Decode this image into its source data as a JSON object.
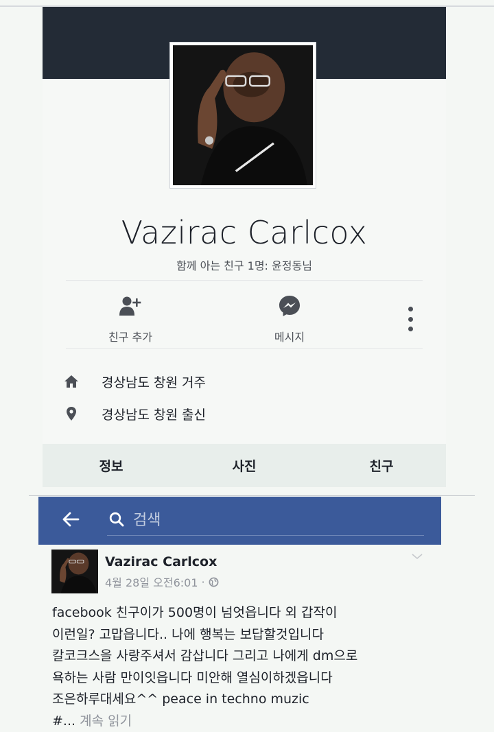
{
  "profile": {
    "name": "Vazirac Carlcox",
    "mutual_friends": "함께 아는 친구 1명: 윤정동님"
  },
  "actions": {
    "add_friend": "친구 추가",
    "message": "메시지"
  },
  "info": {
    "lives_in": "경상남도 창원 거주",
    "from": "경상남도 창원 출신"
  },
  "tabs": [
    "정보",
    "사진",
    "친구"
  ],
  "search": {
    "placeholder": "검색"
  },
  "post": {
    "author": "Vazirac Carlcox",
    "time": "4월 28일 오전6:01",
    "separator": "·",
    "text": "facebook 친구이가 500명이 넘엇읍니다 외 갑작이\n이런일? 고맙읍니다.. 나에 행복는 보답할것입니다\n칼코크스을 사랑주셔서 감삽니다 그리고 나에게 dm으로\n욕하는 사람 만이잇읍니다 미안해 열심이하겠읍니다\n조은하루대세요^^ peace in techno muzic\n#...",
    "read_more": " 계속 읽기"
  },
  "colors": {
    "cover": "#232b36",
    "searchbar": "#3b5a9a",
    "icon": "#4b4f56"
  },
  "icons": [
    "add-friend-icon",
    "messenger-icon",
    "more-icon",
    "home-icon",
    "location-pin-icon",
    "back-arrow-icon",
    "search-icon",
    "chevron-down-icon",
    "globe-icon"
  ]
}
